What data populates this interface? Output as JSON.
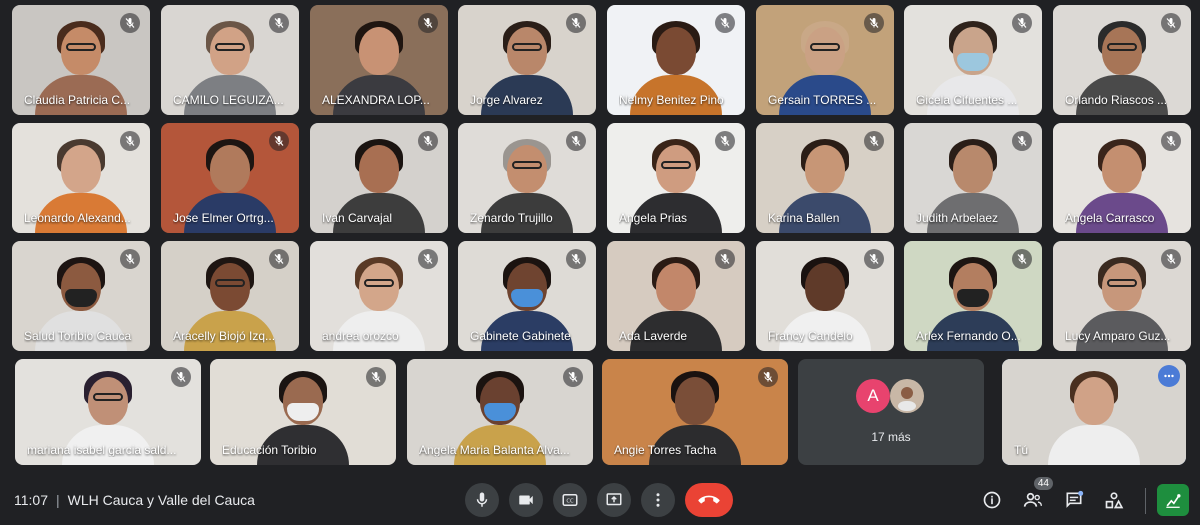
{
  "meeting": {
    "time": "11:07",
    "title": "WLH Cauca y Valle del Cauca"
  },
  "rows": [
    [
      {
        "name": "Claudia Patricia C...",
        "bg": "#c9c6c2",
        "skin": "#c58b68",
        "hair": "#4a2c1d",
        "shirt": "#9b6b54",
        "glasses": true
      },
      {
        "name": "CAMILO LEGUIZA...",
        "bg": "#d9d6d2",
        "skin": "#d1a286",
        "hair": "#6b5647",
        "shirt": "#7d7f83",
        "glasses": true
      },
      {
        "name": "ALEXANDRA LOP...",
        "bg": "#8a6f5a",
        "skin": "#c89274",
        "hair": "#1f1510",
        "shirt": "#3b3b40"
      },
      {
        "name": "Jorge Alvarez",
        "bg": "#d8d3cc",
        "skin": "#b9876a",
        "hair": "#2a1e18",
        "shirt": "#2b3a55",
        "glasses": true
      },
      {
        "name": "Nelmy Benitez Pino",
        "bg": "#f0f2f5",
        "skin": "#7a4a33",
        "hair": "#2a1b14",
        "shirt": "#c7742b"
      },
      {
        "name": "Gersain TORRES ...",
        "bg": "#c2a27a",
        "skin": "#caa184",
        "hair": "#c9a887",
        "shirt": "#2a4a8a",
        "glasses": true
      },
      {
        "name": "Gicela Cifuentes ...",
        "bg": "#e3e1dd",
        "skin": "#c9a48b",
        "hair": "#2e221b",
        "shirt": "#e8e8ea",
        "mask": "#9cc7de"
      },
      {
        "name": "Orlando Riascos ...",
        "bg": "#dcd9d5",
        "skin": "#a77557",
        "hair": "#2b2b2b",
        "shirt": "#4a4a4a",
        "glasses": true
      }
    ],
    [
      {
        "name": "Leonardo Alexand...",
        "bg": "#e4e1dc",
        "skin": "#d3a58a",
        "hair": "#4a3a30",
        "shirt": "#d97a35"
      },
      {
        "name": "Jose Elmer Ortrg...",
        "bg": "#b4563a",
        "skin": "#b07a5c",
        "hair": "#1d1512",
        "shirt": "#2a3b66"
      },
      {
        "name": "Ivan Carvajal",
        "bg": "#d4d1cd",
        "skin": "#a86f52",
        "hair": "#1b1411",
        "shirt": "#3d3d3d"
      },
      {
        "name": "Zenardo Trujillo",
        "bg": "#dfdcd8",
        "skin": "#c38e6f",
        "hair": "#9a9590",
        "shirt": "#3c3c3c",
        "glasses": true
      },
      {
        "name": "Angela Prias",
        "bg": "#eeeeec",
        "skin": "#cf9c80",
        "hair": "#3a2418",
        "shirt": "#2d2d30",
        "glasses": true
      },
      {
        "name": "Karina Ballen",
        "bg": "#d7d0c6",
        "skin": "#c79676",
        "hair": "#2a1d16",
        "shirt": "#3b4a6b"
      },
      {
        "name": "Judith Arbelaez",
        "bg": "#d9d7d4",
        "skin": "#b8896c",
        "hair": "#2a1e18",
        "shirt": "#6e6e70"
      },
      {
        "name": "Angela Carrasco",
        "bg": "#e6e3df",
        "skin": "#c48f70",
        "hair": "#3a251b",
        "shirt": "#6b4a8b"
      }
    ],
    [
      {
        "name": "Salud Toribio Cauca",
        "bg": "#d9d5cf",
        "skin": "#8c5a40",
        "hair": "#1d1412",
        "shirt": "#e0e0e0",
        "mask": "#222222"
      },
      {
        "name": "Aracelly Biojó Izq...",
        "bg": "#d5d0c8",
        "skin": "#7b4a33",
        "hair": "#1e1512",
        "shirt": "#c9a24b",
        "glasses": true
      },
      {
        "name": "andrea orozco",
        "bg": "#e2dfdb",
        "skin": "#d3a68a",
        "hair": "#5a3a26",
        "shirt": "#eeeeee",
        "glasses": true
      },
      {
        "name": "Gabinete Gabinete",
        "bg": "#dedbd6",
        "skin": "#6f4430",
        "hair": "#1b1310",
        "shirt": "#2b3d64",
        "mask": "#4a90d9"
      },
      {
        "name": "Ada Laverde",
        "bg": "#d6cbc0",
        "skin": "#c2876a",
        "hair": "#2b1b14",
        "shirt": "#2d2d2f"
      },
      {
        "name": "Francy Candelo",
        "bg": "#e1ded9",
        "skin": "#5f3a29",
        "hair": "#1a1210",
        "shirt": "#f0f0f0"
      },
      {
        "name": "Arlex Fernando O...",
        "bg": "#cfd8c3",
        "skin": "#b37e60",
        "hair": "#1d1512",
        "shirt": "#2d3d58",
        "mask": "#222222"
      },
      {
        "name": "Lucy Amparo Guz...",
        "bg": "#dcd8d3",
        "skin": "#c7977b",
        "hair": "#3a2a20",
        "shirt": "#5b5b5e",
        "glasses": true
      }
    ]
  ],
  "bottom_row": [
    {
      "name": "mariana isabel garcia sald...",
      "bg": "#e3e1dd",
      "skin": "#c09077",
      "hair": "#2a2030",
      "shirt": "#f0f0f0",
      "glasses": true
    },
    {
      "name": "Educación Toribio",
      "bg": "#e1ddd6",
      "skin": "#9a6a50",
      "hair": "#1b1412",
      "shirt": "#2f2f32",
      "mask": "#eeeeee"
    },
    {
      "name": "Angela Maria Balanta Alva...",
      "bg": "#d8d5d0",
      "skin": "#6a4130",
      "hair": "#1b1310",
      "shirt": "#c9a24b",
      "mask": "#4a90d9"
    },
    {
      "name": "Angie Torres Tacha",
      "bg": "#c9844a",
      "skin": "#7a4e38",
      "hair": "#1a1210",
      "shirt": "#2c2c2e"
    }
  ],
  "more": {
    "initial": "A",
    "initial_color": "#e8436e",
    "label": "17 más"
  },
  "self": {
    "name": "Tú",
    "bg": "#d7d4cf",
    "skin": "#d0a287",
    "hair": "#4a3020",
    "shirt": "#eeeeee"
  },
  "controls": {
    "people_count": "44"
  },
  "colors": {
    "background": "#202124",
    "tile": "#3c4043",
    "leave": "#ea4335",
    "accent": "#8ab4f8",
    "activities": "#1e8e3e"
  },
  "icons": [
    "microphone-off-icon",
    "camera-icon",
    "captions-icon",
    "present-icon",
    "more-options-icon",
    "leave-call-icon",
    "info-icon",
    "people-icon",
    "chat-icon",
    "activities-icon",
    "host-controls-icon"
  ]
}
